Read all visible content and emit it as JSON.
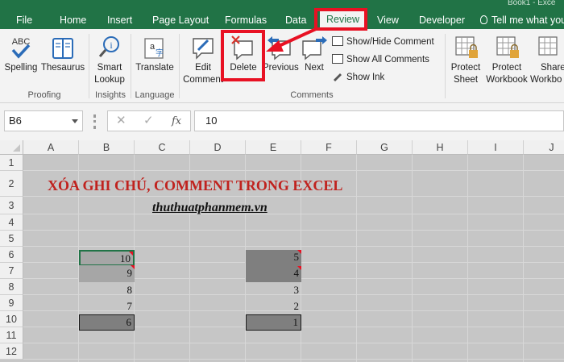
{
  "tabs": {
    "file": "File",
    "home": "Home",
    "insert": "Insert",
    "page_layout": "Page Layout",
    "formulas": "Formulas",
    "data": "Data",
    "review": "Review",
    "view": "View",
    "developer": "Developer",
    "tell_me": "Tell me what you"
  },
  "title_fragment": "Book1 - Exce",
  "ribbon": {
    "spelling": "Spelling",
    "thesaurus": "Thesaurus",
    "group_proofing": "Proofing",
    "smart_lookup_1": "Smart",
    "smart_lookup_2": "Lookup",
    "group_insights": "Insights",
    "translate": "Translate",
    "group_language": "Language",
    "edit_comment_1": "Edit",
    "edit_comment_2": "Comment",
    "delete": "Delete",
    "previous": "Previous",
    "next": "Next",
    "show_hide_comment": "Show/Hide Comment",
    "show_all_comments": "Show All Comments",
    "show_ink": "Show Ink",
    "group_comments": "Comments",
    "protect_sheet_1": "Protect",
    "protect_sheet_2": "Sheet",
    "protect_workbook_1": "Protect",
    "protect_workbook_2": "Workbook",
    "share_workbook_1": "Share",
    "share_workbook_2": "Workbo",
    "abc_label": "ABC"
  },
  "formula_bar": {
    "name_box": "B6",
    "cancel": "✕",
    "enter": "✓",
    "fx": "fx",
    "value": "10"
  },
  "columns": [
    "A",
    "B",
    "C",
    "D",
    "E",
    "F",
    "G",
    "H",
    "I",
    "J"
  ],
  "rows": [
    "1",
    "2",
    "3",
    "4",
    "5",
    "6",
    "7",
    "8",
    "9",
    "10",
    "11",
    "12"
  ],
  "sheet": {
    "heading": "XÓA GHI CHÚ, COMMENT TRONG EXCEL",
    "subheading": "thuthuatphanmem.vn",
    "b6": "10",
    "b7": "9",
    "b8": "8",
    "b9": "7",
    "b10": "6",
    "e6": "5",
    "e7": "4",
    "e8": "3",
    "e9": "2",
    "e10": "1"
  },
  "colors": {
    "excel_green": "#217346",
    "highlight_red": "#e81123",
    "heading_red": "#c0221e"
  }
}
